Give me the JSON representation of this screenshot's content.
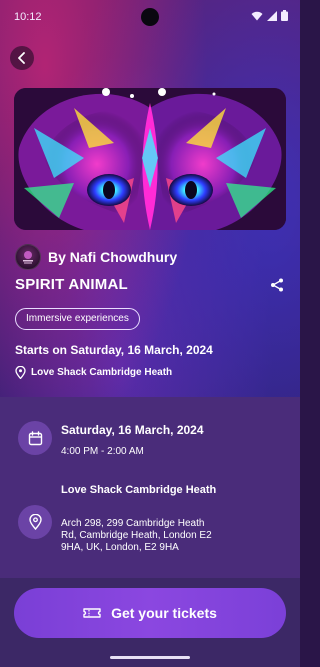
{
  "status_bar": {
    "time": "10:12"
  },
  "hero": {
    "image_desc": "butterfly-artwork"
  },
  "organizer": {
    "prefix": "By",
    "name": "Nafi Chowdhury",
    "display": "By Nafi Chowdhury"
  },
  "event": {
    "title": "SPIRIT ANIMAL",
    "category": "Immersive experiences",
    "starts": "Starts on Saturday, 16 March, 2024",
    "venue_short": "Love Shack Cambridge Heath"
  },
  "details": {
    "date": "Saturday, 16 March, 2024",
    "time": "4:00 PM - 2:00 AM",
    "venue_name": "Love Shack Cambridge Heath",
    "venue_address": "Arch 298, 299 Cambridge Heath Rd, Cambridge Heath, London E2 9HA, UK, London, E2 9HA"
  },
  "cta": {
    "label": "Get your tickets"
  },
  "icons": {
    "back": "arrow-left-icon",
    "share": "share-icon",
    "location": "location-pin-icon",
    "calendar": "calendar-icon",
    "ticket": "ticket-icon"
  },
  "colors": {
    "accent": "#8b47e0",
    "panel": "#4a2c7a",
    "icon_circle": "#6b43a6"
  }
}
